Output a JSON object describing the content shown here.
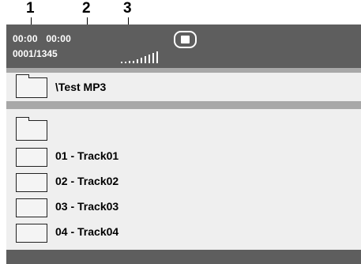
{
  "callouts": [
    "1",
    "2",
    "3"
  ],
  "status": {
    "time_elapsed": "00:00",
    "time_total": "00:00",
    "track_counter": "0001/1345",
    "signal_icon": "signal-strength-bars",
    "mode_icon": "stop-icon"
  },
  "path": {
    "icon": "folder-icon",
    "label": "\\Test MP3"
  },
  "file_list": {
    "parent_icon": "folder-icon",
    "tracks": [
      {
        "icon": "file-icon",
        "label": "01 - Track01"
      },
      {
        "icon": "file-icon",
        "label": "02 - Track02"
      },
      {
        "icon": "file-icon",
        "label": "03 - Track03"
      },
      {
        "icon": "file-icon",
        "label": "04 - Track04"
      }
    ]
  },
  "colors": {
    "status_bar": "#5e5e5e",
    "separator": "#a8a8a8",
    "panel": "#efefef",
    "text_light": "#ffffff",
    "text_dark": "#000000"
  }
}
